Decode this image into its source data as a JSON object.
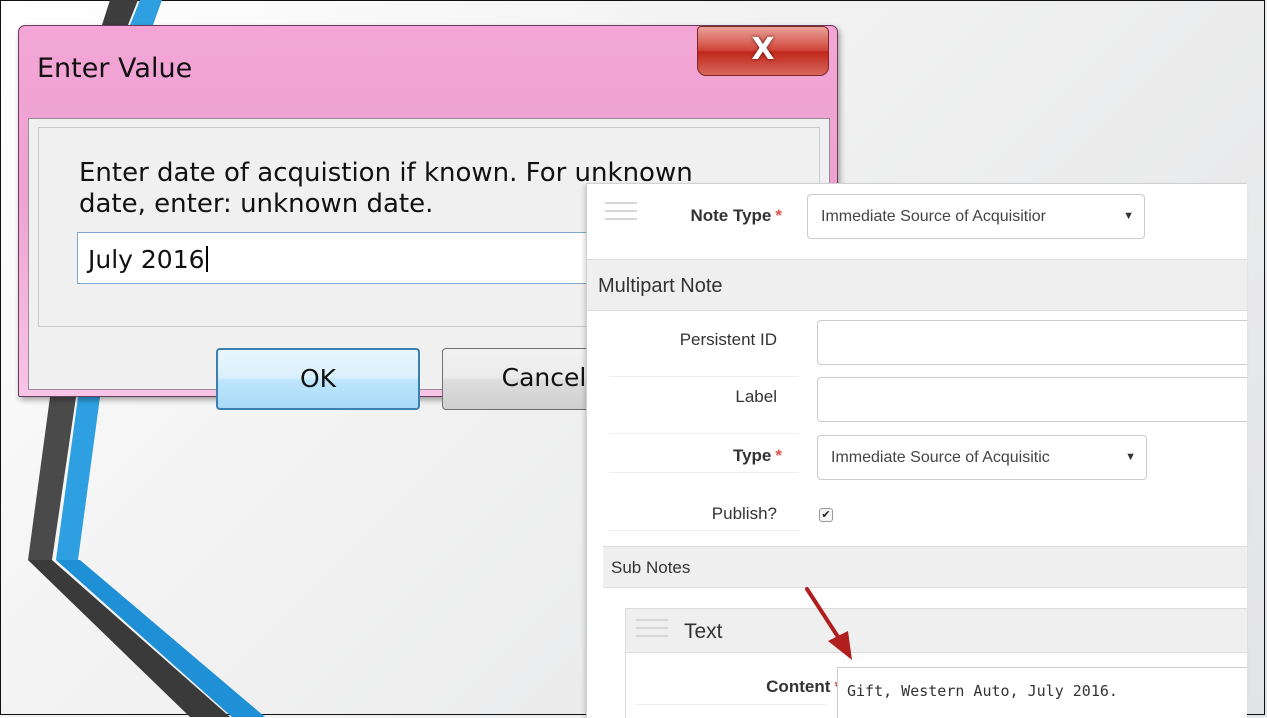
{
  "dialog": {
    "title": "Enter Value",
    "close_glyph": "X",
    "prompt": "Enter date of acquistion if known.  For unknown\ndate, enter: unknown date.",
    "input_value": "July 2016",
    "ok_label": "OK",
    "cancel_label": "Cancel"
  },
  "form": {
    "note_type": {
      "label": "Note Type",
      "required": "*",
      "value": "Immediate Source of Acquisitior"
    },
    "multipart_heading": "Multipart Note",
    "persistent_id": {
      "label": "Persistent ID",
      "value": ""
    },
    "label_field": {
      "label": "Label",
      "value": ""
    },
    "type": {
      "label": "Type",
      "required": "*",
      "value": "Immediate Source of Acquisitic"
    },
    "publish": {
      "label": "Publish?",
      "checked": true
    },
    "sub_notes_heading": "Sub Notes",
    "text_heading": "Text",
    "content": {
      "label": "Content",
      "required": "*",
      "value": "Gift, Western Auto, July 2016."
    }
  },
  "colors": {
    "dialog_frame": "#f0a4d4",
    "close_button": "#c8392d",
    "required_star": "#d9534f",
    "arrow": "#b01e1e",
    "stripe_blue": "#2e9fe0",
    "stripe_gray": "#555555"
  },
  "icons": [
    "close-icon",
    "chevron-down-icon",
    "checkmark-icon",
    "drag-handle-icon"
  ]
}
